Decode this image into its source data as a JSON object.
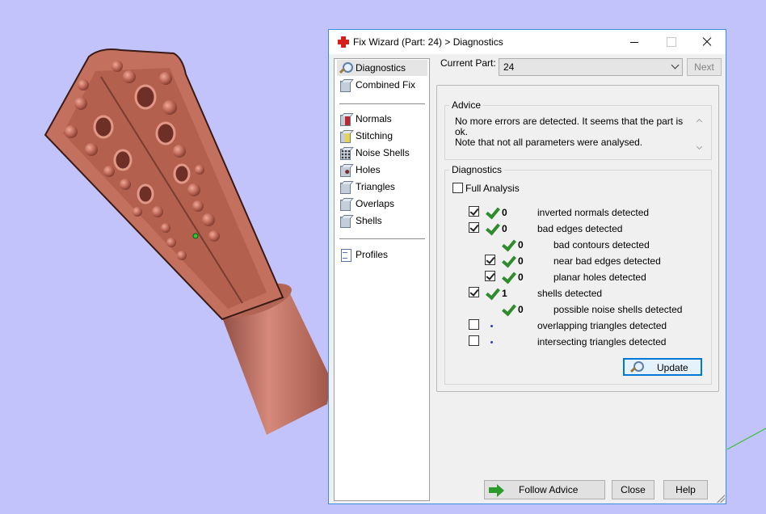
{
  "window": {
    "title": "Fix Wizard (Part: 24) > Diagnostics"
  },
  "nav": {
    "items": [
      {
        "label": "Diagnostics",
        "icon": "magnifier-icon",
        "selected": true
      },
      {
        "label": "Combined Fix",
        "icon": "combined-fix-icon"
      },
      {
        "label": "Normals",
        "icon": "normals-icon"
      },
      {
        "label": "Stitching",
        "icon": "stitching-icon"
      },
      {
        "label": "Noise Shells",
        "icon": "noise-shells-icon"
      },
      {
        "label": "Holes",
        "icon": "holes-icon"
      },
      {
        "label": "Triangles",
        "icon": "triangles-icon"
      },
      {
        "label": "Overlaps",
        "icon": "overlaps-icon"
      },
      {
        "label": "Shells",
        "icon": "shells-icon"
      },
      {
        "label": "Profiles",
        "icon": "profiles-icon"
      }
    ]
  },
  "current_part": {
    "label": "Current Part:",
    "value": "24",
    "next_label": "Next"
  },
  "advice": {
    "title": "Advice",
    "text_line1": "No more errors are detected. It seems that the part is ok.",
    "text_line2": "Note that not all parameters were analysed."
  },
  "diagnostics": {
    "title": "Diagnostics",
    "full_analysis_label": "Full Analysis",
    "full_analysis_checked": false,
    "rows": [
      {
        "checkbox": true,
        "checked": true,
        "status": "ok",
        "count": "0",
        "label": "inverted normals detected",
        "indent": 0
      },
      {
        "checkbox": true,
        "checked": true,
        "status": "ok",
        "count": "0",
        "label": "bad edges detected",
        "indent": 0
      },
      {
        "checkbox": false,
        "checked": false,
        "status": "ok",
        "count": "0",
        "label": "bad contours detected",
        "indent": 1
      },
      {
        "checkbox": true,
        "checked": true,
        "status": "ok",
        "count": "0",
        "label": "near bad edges detected",
        "indent": 1
      },
      {
        "checkbox": true,
        "checked": true,
        "status": "ok",
        "count": "0",
        "label": "planar holes detected",
        "indent": 1
      },
      {
        "checkbox": true,
        "checked": true,
        "status": "ok",
        "count": "1",
        "label": "shells detected",
        "indent": 0
      },
      {
        "checkbox": false,
        "checked": false,
        "status": "ok",
        "count": "0",
        "label": "possible noise shells detected",
        "indent": 1
      },
      {
        "checkbox": true,
        "checked": false,
        "status": "pending",
        "count": "",
        "label": "overlapping triangles detected",
        "indent": 0
      },
      {
        "checkbox": true,
        "checked": false,
        "status": "pending",
        "count": "",
        "label": "intersecting triangles detected",
        "indent": 0
      }
    ],
    "update_label": "Update"
  },
  "buttons": {
    "follow_advice": "Follow Advice",
    "close": "Close",
    "help": "Help"
  },
  "colors": {
    "viewport_bg": "#c3c3fb",
    "model": "#c4705f",
    "ok_tick": "#2e8b2e",
    "pending_dot": "#2a3ad0",
    "accent": "#0078d7"
  }
}
